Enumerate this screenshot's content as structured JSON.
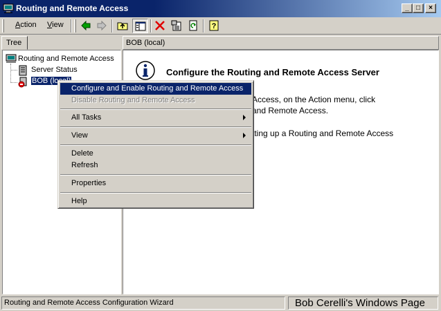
{
  "window": {
    "title": "Routing and Remote Access",
    "minimize_glyph": "_",
    "maximize_glyph": "□",
    "close_glyph": "×"
  },
  "menubar": {
    "action_prefix": "A",
    "action_rest": "ction",
    "view_prefix": "V",
    "view_rest": "iew"
  },
  "toolbar": {
    "icons": [
      "back-arrow-icon",
      "forward-arrow-icon",
      "up-folder-icon",
      "show-hide-tree-icon",
      "delete-icon",
      "properties-icon",
      "refresh-icon",
      "help-icon"
    ]
  },
  "tree": {
    "tab_label": "Tree",
    "root_label": "Routing and Remote Access",
    "server_status_label": "Server Status",
    "server_label": "BOB (local)"
  },
  "right_pane": {
    "header": "BOB (local)",
    "title": "Configure the Routing and Remote Access Server",
    "line1": "Access, on the Action menu, click",
    "line2": "and Remote Access.",
    "line3": "tting up a Routing and Remote Access"
  },
  "context_menu": {
    "items": [
      {
        "label": "Configure and Enable Routing and Remote Access",
        "state": "highlighted"
      },
      {
        "label": "Disable Routing and Remote Access",
        "state": "disabled"
      },
      {
        "label": "All Tasks",
        "submenu": true
      },
      {
        "label": "View",
        "submenu": true
      },
      {
        "label": "Delete"
      },
      {
        "label": "Refresh"
      },
      {
        "label": "Properties"
      },
      {
        "label": "Help"
      }
    ]
  },
  "statusbar": {
    "left": "Routing and Remote Access Configuration Wizard",
    "right": "Bob Cerelli's Windows Page"
  },
  "colors": {
    "titlebar": "#0a246a",
    "highlight": "#0a246a",
    "face": "#d4d0c8"
  }
}
